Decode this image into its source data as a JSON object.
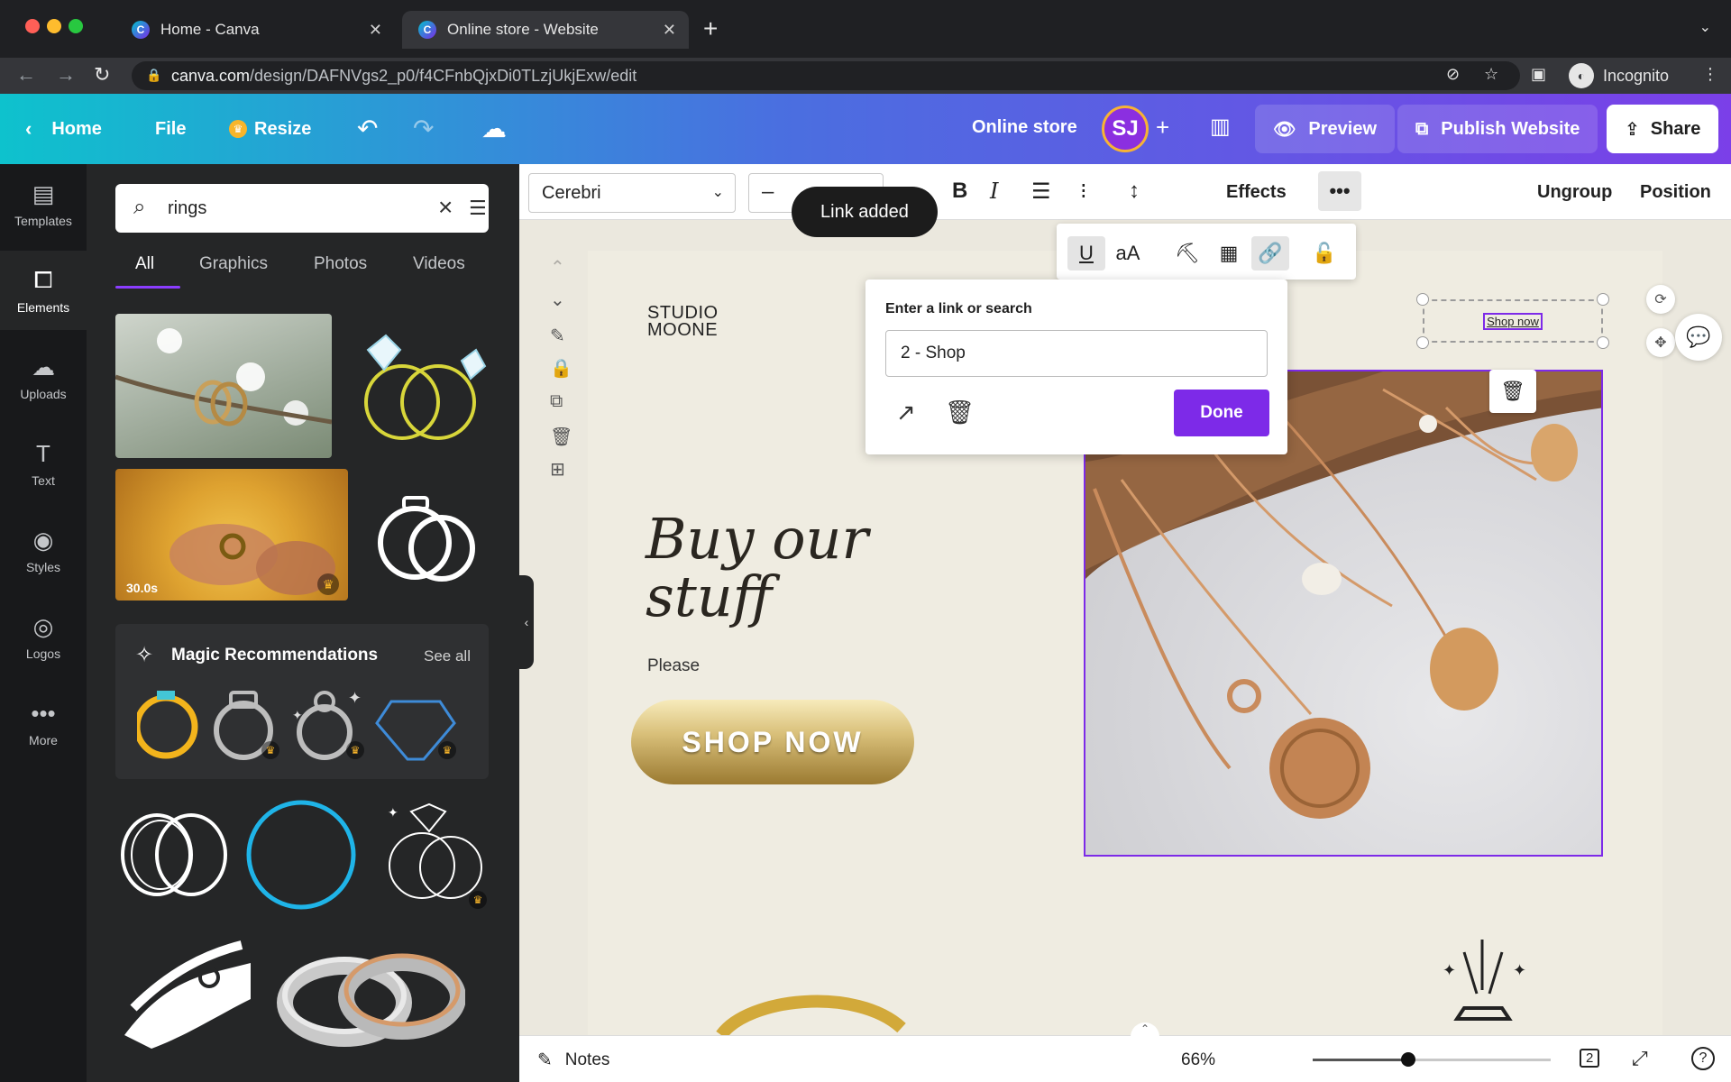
{
  "browser": {
    "tabs": [
      {
        "title": "Home - Canva",
        "active": false
      },
      {
        "title": "Online store - Website",
        "active": true
      }
    ],
    "url_host": "canva.com",
    "url_path": "/design/DAFNVgs2_p0/f4CFnbQjxDi0TLzjUkjExw/edit",
    "profile_label": "Incognito"
  },
  "header": {
    "home": "Home",
    "file": "File",
    "resize": "Resize",
    "design_title": "Online store",
    "avatar_initials": "SJ",
    "preview": "Preview",
    "publish": "Publish Website",
    "share": "Share"
  },
  "rail": [
    {
      "label": "Templates",
      "icon": "templates-icon"
    },
    {
      "label": "Elements",
      "icon": "elements-icon",
      "active": true
    },
    {
      "label": "Uploads",
      "icon": "uploads-icon"
    },
    {
      "label": "Text",
      "icon": "text-icon"
    },
    {
      "label": "Styles",
      "icon": "styles-icon"
    },
    {
      "label": "Logos",
      "icon": "logos-icon"
    },
    {
      "label": "More",
      "icon": "more-icon"
    }
  ],
  "panel": {
    "search_value": "rings",
    "tabs": [
      "All",
      "Graphics",
      "Photos",
      "Videos"
    ],
    "video_duration": "30.0s",
    "magic_title": "Magic Recommendations",
    "see_all": "See all"
  },
  "toolbar": {
    "font": "Cerebri",
    "effects": "Effects",
    "ungroup": "Ungroup",
    "position": "Position"
  },
  "toast": "Link added",
  "link_popup": {
    "label": "Enter a link or search",
    "value": "2 - Shop",
    "done": "Done"
  },
  "canvas": {
    "brand_line1": "STUDIO",
    "brand_line2": "MOONE",
    "headline_line1": "Buy our",
    "headline_line2": "stuff",
    "subtext": "Please",
    "shop_button": "SHOP NOW",
    "selected_text": "Shop now"
  },
  "bottom": {
    "notes": "Notes",
    "zoom": "66%",
    "zoom_fraction": 0.4,
    "page_count": "2"
  },
  "colors": {
    "accent": "#7d2ae8",
    "header_start": "#0ec2cd",
    "header_end": "#7b3fe8",
    "panel_bg": "#252627",
    "canvas_bg": "#efece1"
  }
}
